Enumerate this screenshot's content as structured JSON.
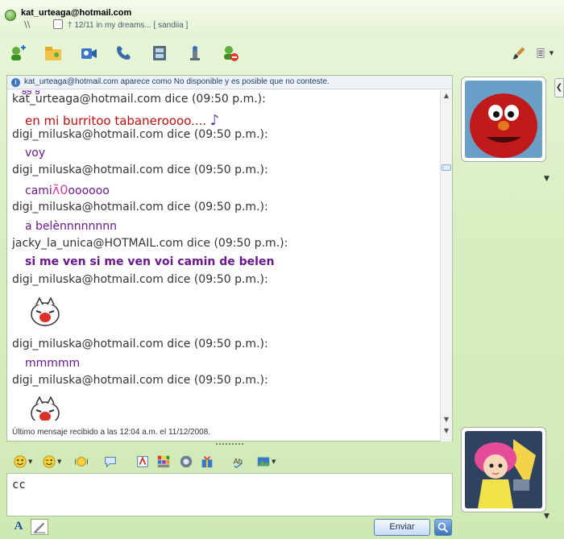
{
  "window": {
    "contact_email": "kat_urteaga@hotmail.com",
    "slashes": "\\\\",
    "personal_message": "† 12/11  in my dreams... [ sandiia ]"
  },
  "info_bar": {
    "text": "kat_urteaga@hotmail.com aparece como No disponible y es posible que no conteste."
  },
  "messages": [
    {
      "sender": "kat_urteaga@hotmail.com dice (09:50 p.m.):",
      "text": "en mi burritoo tabaneroooo....",
      "style": "red"
    },
    {
      "sender": "digi_miluska@hotmail.com dice (09:50 p.m.):",
      "text": "voy",
      "style": "purple"
    },
    {
      "sender": "digi_miluska@hotmail.com dice (09:50 p.m.):",
      "text": "cami",
      "text_after": "oooooo",
      "style": "purple"
    },
    {
      "sender": "digi_miluska@hotmail.com dice (09:50 p.m.):",
      "text": "a belènnnnnnnn",
      "style": "purple"
    },
    {
      "sender": "jacky_la_unica@HOTMAIL.com dice (09:50 p.m.):",
      "text": "si me ven si me ven voi camin de belen",
      "style": "purple"
    },
    {
      "sender": "digi_miluska@hotmail.com dice (09:50 p.m.):",
      "text": "",
      "style": "emoticon"
    },
    {
      "sender": "digi_miluska@hotmail.com dice (09:50 p.m.):",
      "text": "mmmmm",
      "style": "purple"
    },
    {
      "sender": "digi_miluska@hotmail.com dice (09:50 p.m.):",
      "text": "",
      "style": "emoticon"
    }
  ],
  "status_line": "Último mensaje recibido a las 12:04 a.m. el 11/12/2008.",
  "input": {
    "value": "cc"
  },
  "buttons": {
    "send_label": "Enviar"
  },
  "colors": {
    "accent_green": "#cfe9b4",
    "message_red": "#c40c0c",
    "message_purple": "#6b178f"
  }
}
